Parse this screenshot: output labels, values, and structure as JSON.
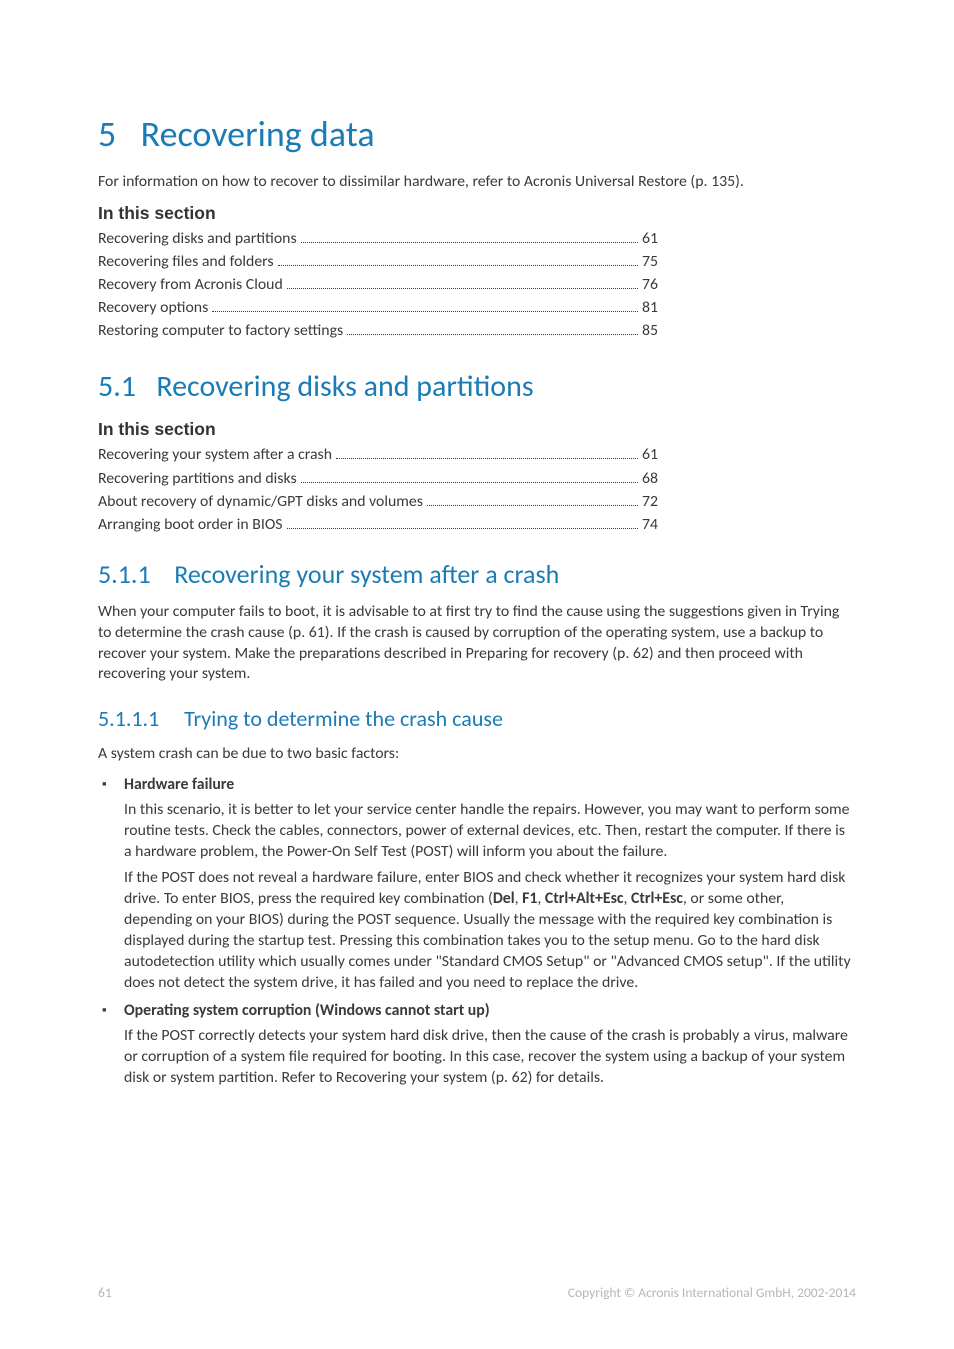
{
  "chapter": {
    "number": "5",
    "title": "Recovering data",
    "intro": "For information on how to recover to dissimilar hardware, refer to Acronis Universal Restore (p. 135)."
  },
  "section_label": "In this section",
  "toc_chapter": [
    {
      "title": "Recovering disks and partitions",
      "page": "61"
    },
    {
      "title": "Recovering files and folders",
      "page": "75"
    },
    {
      "title": "Recovery from Acronis Cloud",
      "page": "76"
    },
    {
      "title": "Recovery options",
      "page": "81"
    },
    {
      "title": "Restoring computer to factory settings",
      "page": "85"
    }
  ],
  "s51": {
    "number": "5.1",
    "title": "Recovering disks and partitions"
  },
  "toc_51": [
    {
      "title": "Recovering your system after a crash",
      "page": "61"
    },
    {
      "title": "Recovering partitions and disks",
      "page": "68"
    },
    {
      "title": "About recovery of dynamic/GPT disks and volumes",
      "page": "72"
    },
    {
      "title": "Arranging boot order in BIOS",
      "page": "74"
    }
  ],
  "s511": {
    "number": "5.1.1",
    "title": "Recovering your system after a crash",
    "para": "When your computer fails to boot, it is advisable to at first try to find the cause using the suggestions given in Trying to determine the crash cause (p. 61). If the crash is caused by corruption of the operating system, use a backup to recover your system. Make the preparations described in Preparing for recovery (p. 62) and then proceed with recovering your system."
  },
  "s5111": {
    "number": "5.1.1.1",
    "title": "Trying to determine the crash cause",
    "intro": "A system crash can be due to two basic factors:",
    "b1_head": "Hardware failure",
    "b1_pre": "In this scenario, it is better to let your service center handle the repairs. However, you may want to perform some routine tests. Check the cables, connectors, power of external devices, etc. Then, restart the computer. If there is a hardware problem, the Power-On Self Test (POST) will inform you about the failure.",
    "b1_post_pre": "If the POST does not reveal a hardware failure, enter BIOS and check whether it recognizes your system hard disk drive. To enter BIOS, press the required key combination (",
    "key_del": "Del",
    "sep_comma1": ", ",
    "key_f1": "F1",
    "sep_comma2": ", ",
    "key_cae": "Ctrl+Alt+Esc",
    "sep_comma3": ", ",
    "key_ce": "Ctrl+Esc",
    "b1_post_suf": ", or some other, depending on your BIOS) during the POST sequence. Usually the message with the required key combination is displayed during the startup test. Pressing this combination takes you to the setup menu. Go to the hard disk autodetection utility which usually comes under \"Standard CMOS Setup\" or \"Advanced CMOS setup\". If the utility does not detect the system drive, it has failed and you need to replace the drive.",
    "b2_head": "Operating system corruption (Windows cannot start up)",
    "b2_para": "If the POST correctly detects your system hard disk drive, then the cause of the crash is probably a virus, malware or corruption of a system file required for booting. In this case, recover the system using a backup of your system disk or system partition. Refer to Recovering your system (p. 62) for details."
  },
  "footer": {
    "page": "61",
    "copyright": "Copyright © Acronis International GmbH, 2002-2014"
  }
}
